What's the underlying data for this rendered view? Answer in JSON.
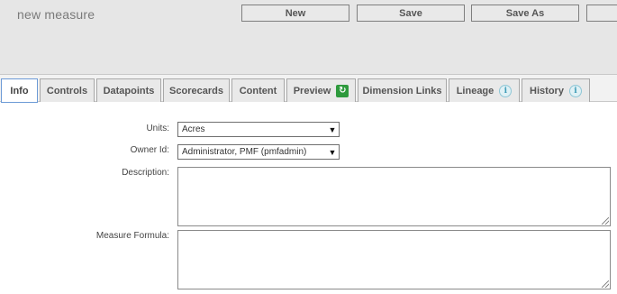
{
  "header": {
    "title": "new measure",
    "buttons": {
      "new": "New",
      "save": "Save",
      "save_as": "Save As"
    }
  },
  "tabs": [
    {
      "label": "Info",
      "active": true
    },
    {
      "label": "Controls"
    },
    {
      "label": "Datapoints"
    },
    {
      "label": "Scorecards"
    },
    {
      "label": "Content"
    },
    {
      "label": "Preview",
      "icon": "refresh-icon"
    },
    {
      "label": "Dimension Links"
    },
    {
      "label": "Lineage",
      "icon": "info-icon"
    },
    {
      "label": "History",
      "icon": "info-icon"
    }
  ],
  "form": {
    "units": {
      "label": "Units:",
      "value": "Acres"
    },
    "owner": {
      "label": "Owner Id:",
      "value": "Administrator, PMF (pmfadmin)"
    },
    "description": {
      "label": "Description:",
      "value": ""
    },
    "formula": {
      "label": "Measure Formula:",
      "value": ""
    }
  },
  "glyphs": {
    "dropdown_arrow": "▼",
    "info": "i",
    "refresh": "↻"
  },
  "colors": {
    "header_bg": "#e6e6e6",
    "active_tab_border": "#6c9ad6",
    "info_icon": "#3f9cb8",
    "refresh_icon": "#2e9a3d"
  }
}
